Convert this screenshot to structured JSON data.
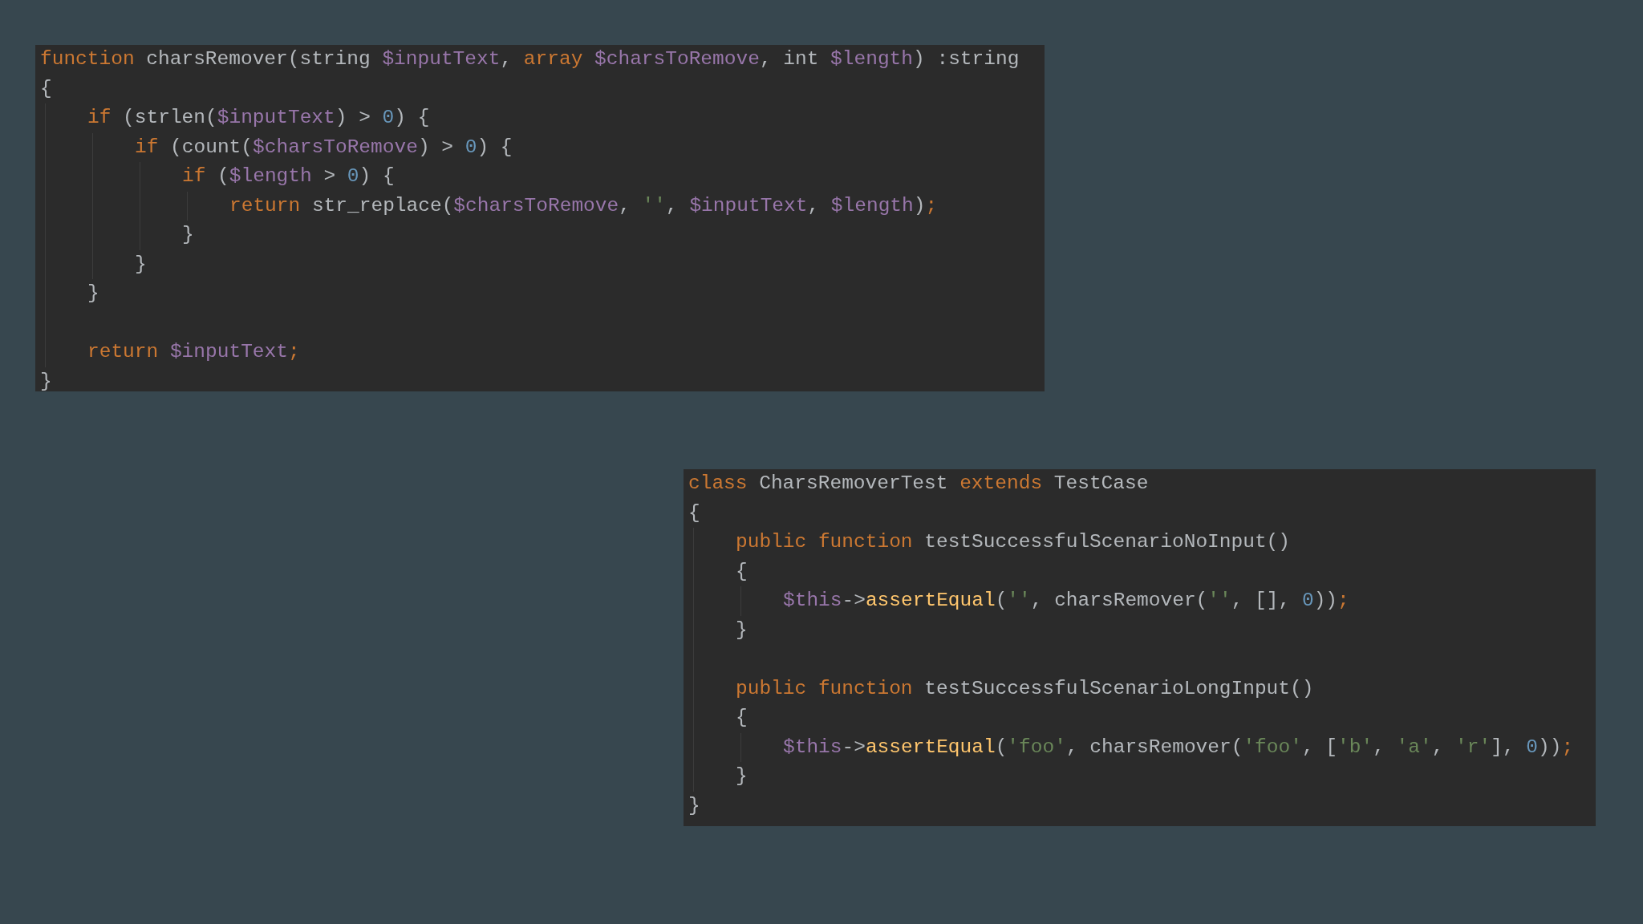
{
  "code_panels": [
    {
      "lines": [
        {
          "kind": "code",
          "tokens": [
            {
              "text": "function",
              "kind": "keyword"
            },
            {
              "text": " charsRemover(string ",
              "kind": "plain"
            },
            {
              "text": "$inputText",
              "kind": "variable"
            },
            {
              "text": ", ",
              "kind": "plain"
            },
            {
              "text": "array",
              "kind": "keyword"
            },
            {
              "text": " $charsToRemove",
              "kind": "variable"
            },
            {
              "text": ", int ",
              "kind": "plain"
            },
            {
              "text": "$length",
              "kind": "variable"
            },
            {
              "text": ") :string",
              "kind": "plain"
            }
          ]
        },
        {
          "kind": "code",
          "tokens": [
            {
              "text": "{",
              "kind": "plain"
            }
          ],
          "children": [
            {
              "kind": "code",
              "tokens": [
                {
                  "text": "if",
                  "kind": "keyword"
                },
                {
                  "text": " (strlen(",
                  "kind": "plain"
                },
                {
                  "text": "$inputText",
                  "kind": "variable"
                },
                {
                  "text": ") > ",
                  "kind": "plain"
                },
                {
                  "text": "0",
                  "kind": "number"
                },
                {
                  "text": ") {",
                  "kind": "plain"
                }
              ],
              "children": [
                {
                  "kind": "code",
                  "tokens": [
                    {
                      "text": "if",
                      "kind": "keyword"
                    },
                    {
                      "text": " (count(",
                      "kind": "plain"
                    },
                    {
                      "text": "$charsToRemove",
                      "kind": "variable"
                    },
                    {
                      "text": ") > ",
                      "kind": "plain"
                    },
                    {
                      "text": "0",
                      "kind": "number"
                    },
                    {
                      "text": ") {",
                      "kind": "plain"
                    }
                  ],
                  "children": [
                    {
                      "kind": "code",
                      "tokens": [
                        {
                          "text": "if",
                          "kind": "keyword"
                        },
                        {
                          "text": " (",
                          "kind": "plain"
                        },
                        {
                          "text": "$length",
                          "kind": "variable"
                        },
                        {
                          "text": " > ",
                          "kind": "plain"
                        },
                        {
                          "text": "0",
                          "kind": "number"
                        },
                        {
                          "text": ") {",
                          "kind": "plain"
                        }
                      ],
                      "children": [
                        {
                          "kind": "code",
                          "tokens": [
                            {
                              "text": "return",
                              "kind": "keyword"
                            },
                            {
                              "text": " str_replace(",
                              "kind": "plain"
                            },
                            {
                              "text": "$charsToRemove",
                              "kind": "variable"
                            },
                            {
                              "text": ", ",
                              "kind": "plain"
                            },
                            {
                              "text": "''",
                              "kind": "string"
                            },
                            {
                              "text": ", ",
                              "kind": "plain"
                            },
                            {
                              "text": "$inputText",
                              "kind": "variable"
                            },
                            {
                              "text": ", ",
                              "kind": "plain"
                            },
                            {
                              "text": "$length",
                              "kind": "variable"
                            },
                            {
                              "text": ")",
                              "kind": "plain"
                            },
                            {
                              "text": ";",
                              "kind": "keyword"
                            }
                          ]
                        }
                      ]
                    },
                    {
                      "kind": "code",
                      "tokens": [
                        {
                          "text": "}",
                          "kind": "plain"
                        }
                      ]
                    }
                  ]
                },
                {
                  "kind": "code",
                  "tokens": [
                    {
                      "text": "}",
                      "kind": "plain"
                    }
                  ]
                }
              ]
            },
            {
              "kind": "code",
              "tokens": [
                {
                  "text": "}",
                  "kind": "plain"
                }
              ]
            },
            {
              "kind": "blank"
            },
            {
              "kind": "code",
              "tokens": [
                {
                  "text": "return",
                  "kind": "keyword"
                },
                {
                  "text": " $inputText",
                  "kind": "variable"
                },
                {
                  "text": ";",
                  "kind": "keyword"
                }
              ]
            }
          ]
        },
        {
          "kind": "code",
          "tokens": [
            {
              "text": "}",
              "kind": "plain"
            }
          ]
        }
      ]
    },
    {
      "lines": [
        {
          "kind": "code",
          "tokens": [
            {
              "text": "class",
              "kind": "keyword"
            },
            {
              "text": " CharsRemoverTest ",
              "kind": "plain"
            },
            {
              "text": "extends",
              "kind": "keyword"
            },
            {
              "text": " TestCase",
              "kind": "plain"
            }
          ]
        },
        {
          "kind": "code",
          "tokens": [
            {
              "text": "{",
              "kind": "plain"
            }
          ],
          "children": [
            {
              "kind": "code",
              "tokens": [
                {
                  "text": "public",
                  "kind": "keyword"
                },
                {
                  "text": " function",
                  "kind": "keyword"
                },
                {
                  "text": " testSuccessfulScenarioNoInput()",
                  "kind": "plain"
                }
              ]
            },
            {
              "kind": "code",
              "tokens": [
                {
                  "text": "{",
                  "kind": "plain"
                }
              ],
              "children": [
                {
                  "kind": "code",
                  "tokens": [
                    {
                      "text": "$this",
                      "kind": "variable"
                    },
                    {
                      "text": "->",
                      "kind": "plain"
                    },
                    {
                      "text": "assertEqual",
                      "kind": "function"
                    },
                    {
                      "text": "(",
                      "kind": "plain"
                    },
                    {
                      "text": "''",
                      "kind": "string"
                    },
                    {
                      "text": ", charsRemover(",
                      "kind": "plain"
                    },
                    {
                      "text": "''",
                      "kind": "string"
                    },
                    {
                      "text": ", [], ",
                      "kind": "plain"
                    },
                    {
                      "text": "0",
                      "kind": "number"
                    },
                    {
                      "text": "))",
                      "kind": "plain"
                    },
                    {
                      "text": ";",
                      "kind": "keyword"
                    }
                  ]
                }
              ]
            },
            {
              "kind": "code",
              "tokens": [
                {
                  "text": "}",
                  "kind": "plain"
                }
              ]
            },
            {
              "kind": "blank"
            },
            {
              "kind": "code",
              "tokens": [
                {
                  "text": "public",
                  "kind": "keyword"
                },
                {
                  "text": " function",
                  "kind": "keyword"
                },
                {
                  "text": " testSuccessfulScenarioLongInput()",
                  "kind": "plain"
                }
              ]
            },
            {
              "kind": "code",
              "tokens": [
                {
                  "text": "{",
                  "kind": "plain"
                }
              ],
              "children": [
                {
                  "kind": "code",
                  "tokens": [
                    {
                      "text": "$this",
                      "kind": "variable"
                    },
                    {
                      "text": "->",
                      "kind": "plain"
                    },
                    {
                      "text": "assertEqual",
                      "kind": "function"
                    },
                    {
                      "text": "(",
                      "kind": "plain"
                    },
                    {
                      "text": "'foo'",
                      "kind": "string"
                    },
                    {
                      "text": ", charsRemover(",
                      "kind": "plain"
                    },
                    {
                      "text": "'foo'",
                      "kind": "string"
                    },
                    {
                      "text": ", [",
                      "kind": "plain"
                    },
                    {
                      "text": "'b'",
                      "kind": "string"
                    },
                    {
                      "text": ", ",
                      "kind": "plain"
                    },
                    {
                      "text": "'a'",
                      "kind": "string"
                    },
                    {
                      "text": ", ",
                      "kind": "plain"
                    },
                    {
                      "text": "'r'",
                      "kind": "string"
                    },
                    {
                      "text": "], ",
                      "kind": "plain"
                    },
                    {
                      "text": "0",
                      "kind": "number"
                    },
                    {
                      "text": "))",
                      "kind": "plain"
                    },
                    {
                      "text": ";",
                      "kind": "keyword"
                    }
                  ]
                }
              ]
            },
            {
              "kind": "code",
              "tokens": [
                {
                  "text": "}",
                  "kind": "plain"
                }
              ]
            }
          ]
        },
        {
          "kind": "code",
          "tokens": [
            {
              "text": "}",
              "kind": "plain"
            }
          ]
        }
      ]
    }
  ]
}
